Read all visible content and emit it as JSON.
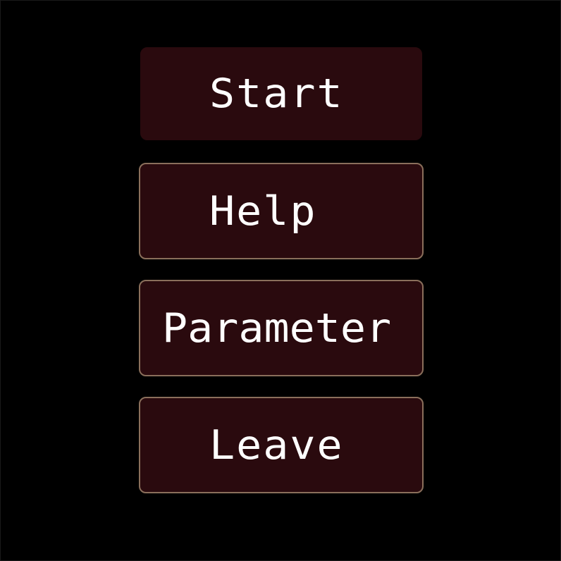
{
  "menu": {
    "items": [
      {
        "id": "start",
        "label": "Start",
        "state": "selected"
      },
      {
        "id": "help",
        "label": "Help",
        "state": "normal"
      },
      {
        "id": "parameter",
        "label": "Parameter",
        "state": "normal"
      },
      {
        "id": "leave",
        "label": "Leave",
        "state": "normal"
      }
    ]
  },
  "colors": {
    "background": "#000000",
    "button_fill": "#2a0a0e",
    "button_border": "#8a6f5b",
    "text": "#ffffff"
  }
}
